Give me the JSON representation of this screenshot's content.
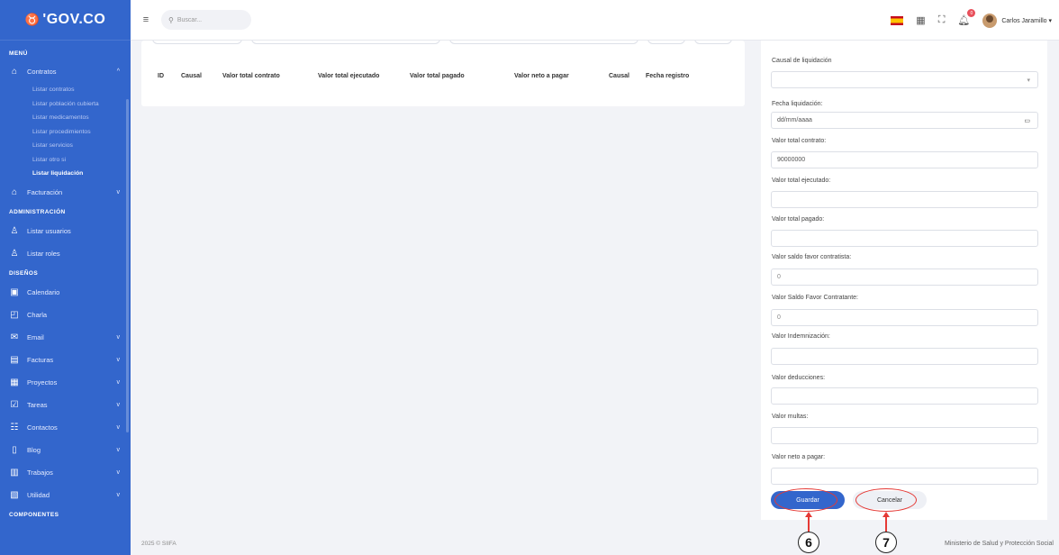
{
  "logo": {
    "mark": "♉",
    "text": "'GOV.CO"
  },
  "sidebar": {
    "menu_title": "MENÚ",
    "contratos": {
      "label": "Contratos",
      "chev": "^"
    },
    "contratos_subitems": [
      "Listar contratos",
      "Listar población cubierta",
      "Listar medicamentos",
      "Listar procedimientos",
      "Listar servicios",
      "Listar otro si",
      "Listar liquidación"
    ],
    "facturacion": {
      "label": "Facturación",
      "chev": "v"
    },
    "admin_title": "ADMINISTRACIÓN",
    "listar_usuarios": "Listar usuarios",
    "listar_roles": "Listar roles",
    "disenos_title": "DISEÑOS",
    "disenos_items": [
      {
        "label": "Calendario",
        "icon": "calendar-icon",
        "glyph": "▣",
        "chev": ""
      },
      {
        "label": "Charla",
        "icon": "chat-icon",
        "glyph": "◰",
        "chev": ""
      },
      {
        "label": "Email",
        "icon": "mail-icon",
        "glyph": "✉",
        "chev": "v"
      },
      {
        "label": "Facturas",
        "icon": "invoice-icon",
        "glyph": "▤",
        "chev": "v"
      },
      {
        "label": "Proyectos",
        "icon": "projects-icon",
        "glyph": "▦",
        "chev": "v"
      },
      {
        "label": "Tareas",
        "icon": "tasks-icon",
        "glyph": "☑",
        "chev": "v"
      },
      {
        "label": "Contactos",
        "icon": "contacts-icon",
        "glyph": "☷",
        "chev": "v"
      },
      {
        "label": "Blog",
        "icon": "blog-icon",
        "glyph": "▯",
        "chev": "v"
      },
      {
        "label": "Trabajos",
        "icon": "jobs-icon",
        "glyph": "▥",
        "chev": "v"
      },
      {
        "label": "Utilidad",
        "icon": "utility-icon",
        "glyph": "▧",
        "chev": "v"
      }
    ],
    "components_title": "COMPONENTES"
  },
  "topbar": {
    "search_placeholder": "Buscar...",
    "notification_count": "0",
    "user_name": "Carlos Jaramillo ▾"
  },
  "table": {
    "headers": [
      "ID",
      "Causal",
      "Valor total contrato",
      "Valor total ejecutado",
      "Valor total pagado",
      "Valor neto a pagar",
      "Causal",
      "Fecha registro"
    ]
  },
  "form": {
    "causal_label": "Causal de liquidación",
    "causal_value": "",
    "fecha_label": "Fecha liquidación:",
    "fecha_value": "dd/mm/aaaa",
    "total_contrato_label": "Valor total contrato:",
    "total_contrato_value": "90000000",
    "total_ejecutado_label": "Valor total ejecutado:",
    "total_ejecutado_value": "",
    "total_pagado_label": "Valor total pagado:",
    "total_pagado_value": "",
    "saldo_contratista_label": "Valor saldo favor contratista:",
    "saldo_contratista_value": "0",
    "saldo_contratante_label": "Valor Saldo Favor Contratante:",
    "saldo_contratante_value": "0",
    "indemnizacion_label": "Valor Indemnización:",
    "indemnizacion_value": "",
    "deducciones_label": "Valor deducciones:",
    "deducciones_value": "",
    "multas_label": "Valor multas:",
    "multas_value": "",
    "neto_label": "Valor neto a pagar:",
    "neto_value": "",
    "save_label": "Guardar",
    "cancel_label": "Cancelar"
  },
  "annotations": {
    "save_number": "6",
    "cancel_number": "7"
  },
  "footer": {
    "left": "2025 © SIIFA",
    "right": "Ministerio de Salud y Protección Social"
  },
  "colors": {
    "primary": "#3366cc",
    "annotation": "#e53935"
  }
}
